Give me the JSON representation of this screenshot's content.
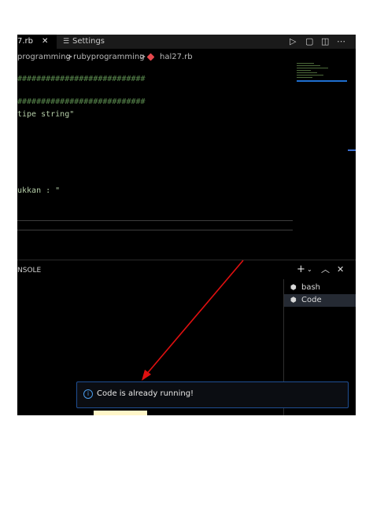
{
  "tabs": {
    "active_label": "7.rb",
    "close_glyph": "✕",
    "settings_label": "Settings"
  },
  "breadcrumb": {
    "part1": "programming",
    "sep1": ">",
    "part2": "rubyprogramming",
    "sep2": ">",
    "file": "hal27.rb"
  },
  "code": {
    "line1": "###########################",
    "line2": "###########################",
    "line3": "tipe string\"",
    "line4": "ukkan : \""
  },
  "panel": {
    "title": "NSOLE",
    "terminals": [
      "bash",
      "Code"
    ]
  },
  "notification": {
    "message": "Code is already running!"
  },
  "icons": {
    "run": "run-icon",
    "split": "split-editor-icon",
    "more": "more-actions-icon",
    "add_terminal": "plus-icon",
    "maximize": "chevron-up-icon",
    "close_panel": "close-icon",
    "info": "info-icon"
  },
  "colors": {
    "background": "#000000",
    "accent": "#1f4f94",
    "arrow": "#e01010",
    "string": "#b5cea8",
    "comment": "#5a8a4e"
  }
}
